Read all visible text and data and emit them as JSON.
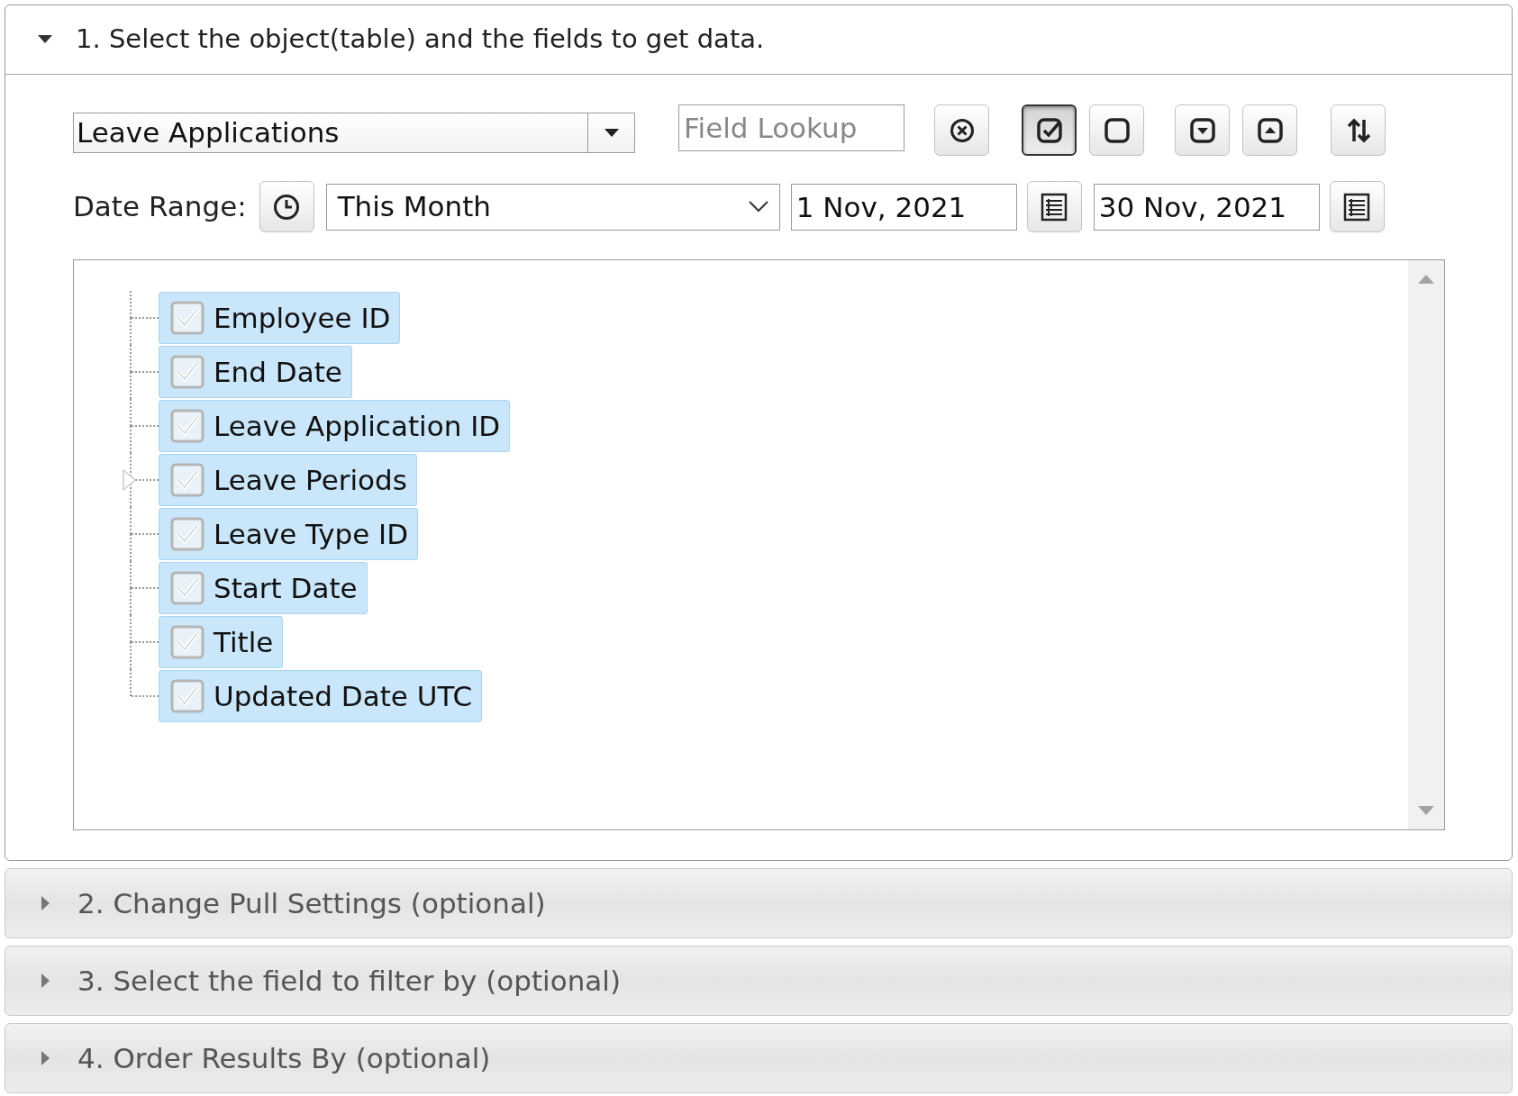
{
  "sections": [
    {
      "title": "1. Select the object(table) and the fields to get data.",
      "expanded": true
    },
    {
      "title": "2. Change Pull Settings (optional)",
      "expanded": false
    },
    {
      "title": "3. Select the field to filter by (optional)",
      "expanded": false
    },
    {
      "title": "4. Order Results By (optional)",
      "expanded": false
    }
  ],
  "object_select": {
    "value": "Leave Applications"
  },
  "field_lookup": {
    "placeholder": "Field Lookup"
  },
  "toolbar": [
    {
      "kind": "clear",
      "pressed": false
    },
    {
      "kind": "check_all",
      "pressed": true
    },
    {
      "kind": "uncheck_all",
      "pressed": false
    },
    {
      "kind": "collapse",
      "pressed": false
    },
    {
      "kind": "expand",
      "pressed": false
    },
    {
      "kind": "sort",
      "pressed": false
    }
  ],
  "date_range": {
    "label": "Date Range:",
    "preset": "This Month",
    "from": "1 Nov, 2021",
    "to": "30 Nov, 2021"
  },
  "fields": [
    {
      "label": "Employee ID",
      "checked": true,
      "expandable": false
    },
    {
      "label": "End Date",
      "checked": true,
      "expandable": false
    },
    {
      "label": "Leave Application ID",
      "checked": true,
      "expandable": false
    },
    {
      "label": "Leave Periods",
      "checked": true,
      "expandable": true
    },
    {
      "label": "Leave Type ID",
      "checked": true,
      "expandable": false
    },
    {
      "label": "Start Date",
      "checked": true,
      "expandable": false
    },
    {
      "label": "Title",
      "checked": true,
      "expandable": false
    },
    {
      "label": "Updated Date UTC",
      "checked": true,
      "expandable": false
    }
  ]
}
